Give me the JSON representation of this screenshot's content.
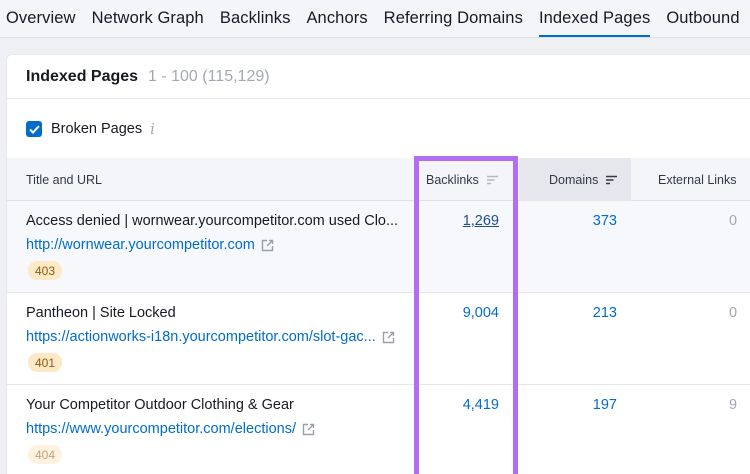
{
  "tabs": [
    {
      "label": "Overview",
      "active": false
    },
    {
      "label": "Network Graph",
      "active": false
    },
    {
      "label": "Backlinks",
      "active": false
    },
    {
      "label": "Anchors",
      "active": false
    },
    {
      "label": "Referring Domains",
      "active": false
    },
    {
      "label": "Indexed Pages",
      "active": true
    },
    {
      "label": "Outbound",
      "active": false
    }
  ],
  "panel": {
    "title": "Indexed Pages",
    "range": "1 - 100 (115,129)"
  },
  "filter": {
    "label": "Broken Pages",
    "checked": true,
    "info_icon": "info-icon"
  },
  "table": {
    "columns": {
      "title_url": "Title and URL",
      "backlinks": "Backlinks",
      "domains": "Domains",
      "external_links": "External Links"
    },
    "rows": [
      {
        "title": "Access denied | wornwear.yourcompetitor.com used Clo...",
        "url": "http://wornwear.yourcompetitor.com",
        "status": "403",
        "backlinks": "1,269",
        "domains": "373",
        "external_links": "0"
      },
      {
        "title": "Pantheon | Site Locked",
        "url": "https://actionworks-i18n.yourcompetitor.com/slot-gac...",
        "status": "401",
        "backlinks": "9,004",
        "domains": "213",
        "external_links": "0"
      },
      {
        "title": "Your Competitor Outdoor Clothing & Gear",
        "url": "https://www.yourcompetitor.com/elections/",
        "status": "404",
        "backlinks": "4,419",
        "domains": "197",
        "external_links": "9"
      }
    ]
  },
  "colors": {
    "accent": "#006dca",
    "highlight": "#b26df0",
    "badge_bg": "#fde9c5"
  }
}
